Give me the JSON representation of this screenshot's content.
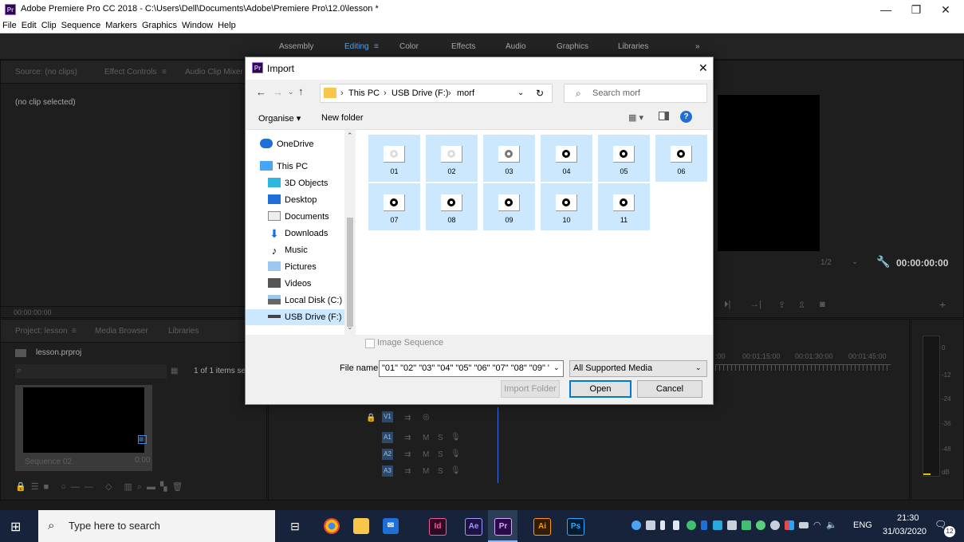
{
  "window": {
    "title": "Adobe Premiere Pro CC 2018 - C:\\Users\\Dell\\Documents\\Adobe\\Premiere Pro\\12.0\\lesson *",
    "app_tag": "Pr",
    "controls": {
      "minimize": "—",
      "maximize": "❐",
      "close": "✕"
    }
  },
  "menu": [
    "File",
    "Edit",
    "Clip",
    "Sequence",
    "Markers",
    "Graphics",
    "Window",
    "Help"
  ],
  "workspaces": [
    {
      "label": "Assembly",
      "active": false
    },
    {
      "label": "Editing",
      "active": true
    },
    {
      "label": "Color",
      "active": false
    },
    {
      "label": "Effects",
      "active": false
    },
    {
      "label": "Audio",
      "active": false
    },
    {
      "label": "Graphics",
      "active": false
    },
    {
      "label": "Libraries",
      "active": false
    }
  ],
  "workspace_overflow": "»",
  "source_panel": {
    "tabs": [
      "Source: (no clips)",
      "Effect Controls",
      "Audio Clip Mixer"
    ],
    "tab_menu_icon": "≡",
    "no_clip": "(no clip selected)",
    "timecode": "00:00:00:00"
  },
  "program_panel": {
    "zoom": "1/2",
    "timecode": "00:00:00:00"
  },
  "project_panel": {
    "tabs": [
      "Project: lesson",
      "Media Browser",
      "Libraries"
    ],
    "tab_menu_icon": "≡",
    "file": "lesson.prproj",
    "items_selected": "1 of 1 items sel",
    "clip_name": "Sequence 02",
    "clip_duration": "0:00"
  },
  "timeline": {
    "ruler": [
      ":00",
      "00:01:15:00",
      "00:01:30:00",
      "00:01:45:00"
    ],
    "tracks": [
      {
        "name": "V1",
        "kind": "video"
      },
      {
        "name": "A1",
        "kind": "audio"
      },
      {
        "name": "A2",
        "kind": "audio"
      },
      {
        "name": "A3",
        "kind": "audio"
      }
    ],
    "track_toggles": {
      "sync": "⇉",
      "mute": "M",
      "solo": "S"
    }
  },
  "meter_labels": [
    "0",
    "-12",
    "-24",
    "-36",
    "-48",
    "dB"
  ],
  "dialog": {
    "title": "Import",
    "app_tag": "Pr",
    "path": [
      "This PC",
      "USB Drive (F:)",
      "morf"
    ],
    "search_placeholder": "Search morf",
    "toolbar": {
      "organise": "Organise ▾",
      "new_folder": "New folder"
    },
    "nav": [
      {
        "label": "OneDrive",
        "icon": "cloud-icon"
      },
      {
        "label": "This PC",
        "icon": "computer-icon"
      },
      {
        "label": "3D Objects",
        "icon": "cube-icon"
      },
      {
        "label": "Desktop",
        "icon": "desktop-icon"
      },
      {
        "label": "Documents",
        "icon": "document-icon"
      },
      {
        "label": "Downloads",
        "icon": "download-icon"
      },
      {
        "label": "Music",
        "icon": "music-icon"
      },
      {
        "label": "Pictures",
        "icon": "pictures-icon"
      },
      {
        "label": "Videos",
        "icon": "videos-icon"
      },
      {
        "label": "Local Disk (C:)",
        "icon": "disk-icon"
      },
      {
        "label": "USB Drive (F:)",
        "icon": "usb-icon"
      }
    ],
    "files": [
      "01",
      "02",
      "03",
      "04",
      "05",
      "06",
      "07",
      "08",
      "09",
      "10",
      "11"
    ],
    "image_sequence": "Image Sequence",
    "file_name_label": "File name:",
    "file_name_value": "\"01\" \"02\" \"03\" \"04\" \"05\" \"06\" \"07\" \"08\" \"09\" \"1",
    "file_type": "All Supported Media",
    "import_folder": "Import Folder",
    "open": "Open",
    "cancel": "Cancel"
  },
  "taskbar": {
    "search_placeholder": "Type here to search",
    "apps": [
      {
        "name": "task-view",
        "label": "⊟"
      },
      {
        "name": "chrome",
        "label": ""
      },
      {
        "name": "file-explorer",
        "label": ""
      },
      {
        "name": "mail",
        "label": "✉"
      },
      {
        "name": "indesign",
        "label": "Id"
      },
      {
        "name": "after-effects",
        "label": "Ae"
      },
      {
        "name": "premiere",
        "label": "Pr"
      },
      {
        "name": "illustrator",
        "label": "Ai"
      },
      {
        "name": "photoshop",
        "label": "Ps"
      }
    ],
    "language": "ENG",
    "time": "21:30",
    "date": "31/03/2020",
    "notification_count": "12"
  },
  "colors": {
    "tile_selected": "#cce8ff",
    "workspace_active": "#4aa3f5",
    "premiere_purple": "#2a0a4a",
    "playhead": "#3f6fe8",
    "taskbar": "#16233a"
  }
}
